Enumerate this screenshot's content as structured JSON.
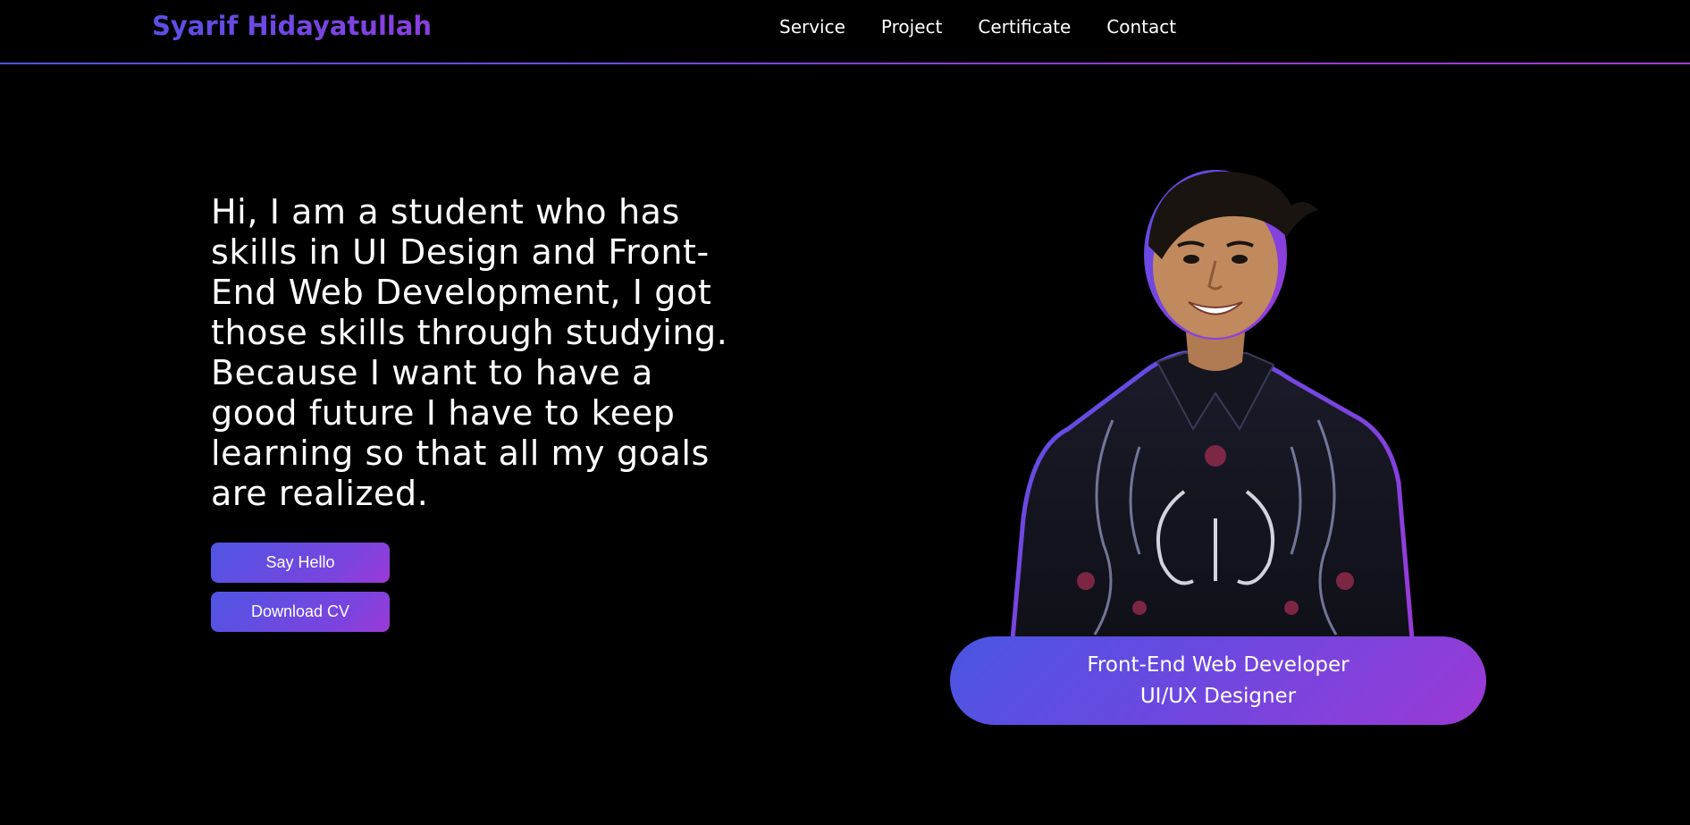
{
  "header": {
    "logo": "Syarif Hidayatullah",
    "nav": [
      "Service",
      "Project",
      "Certificate",
      "Contact"
    ]
  },
  "hero": {
    "text_lines": [
      "Hi, I am a student who has",
      "skills in UI Design and Front-",
      "End Web Development, I got",
      "those skills through studying.",
      "Because I want to have a",
      "good future I have to keep",
      "learning so that all my goals",
      "are realized."
    ],
    "say_hello_label": "Say Hello",
    "download_cv_label": "Download CV"
  },
  "profile": {
    "photo_icon": "person-photo",
    "roles": [
      "Front-End Web Developer",
      "UI/UX Designer"
    ]
  },
  "colors": {
    "background": "#000000",
    "accent_start": "#4f55e3",
    "accent_end": "#9b3ad7",
    "text": "#ffffff"
  }
}
